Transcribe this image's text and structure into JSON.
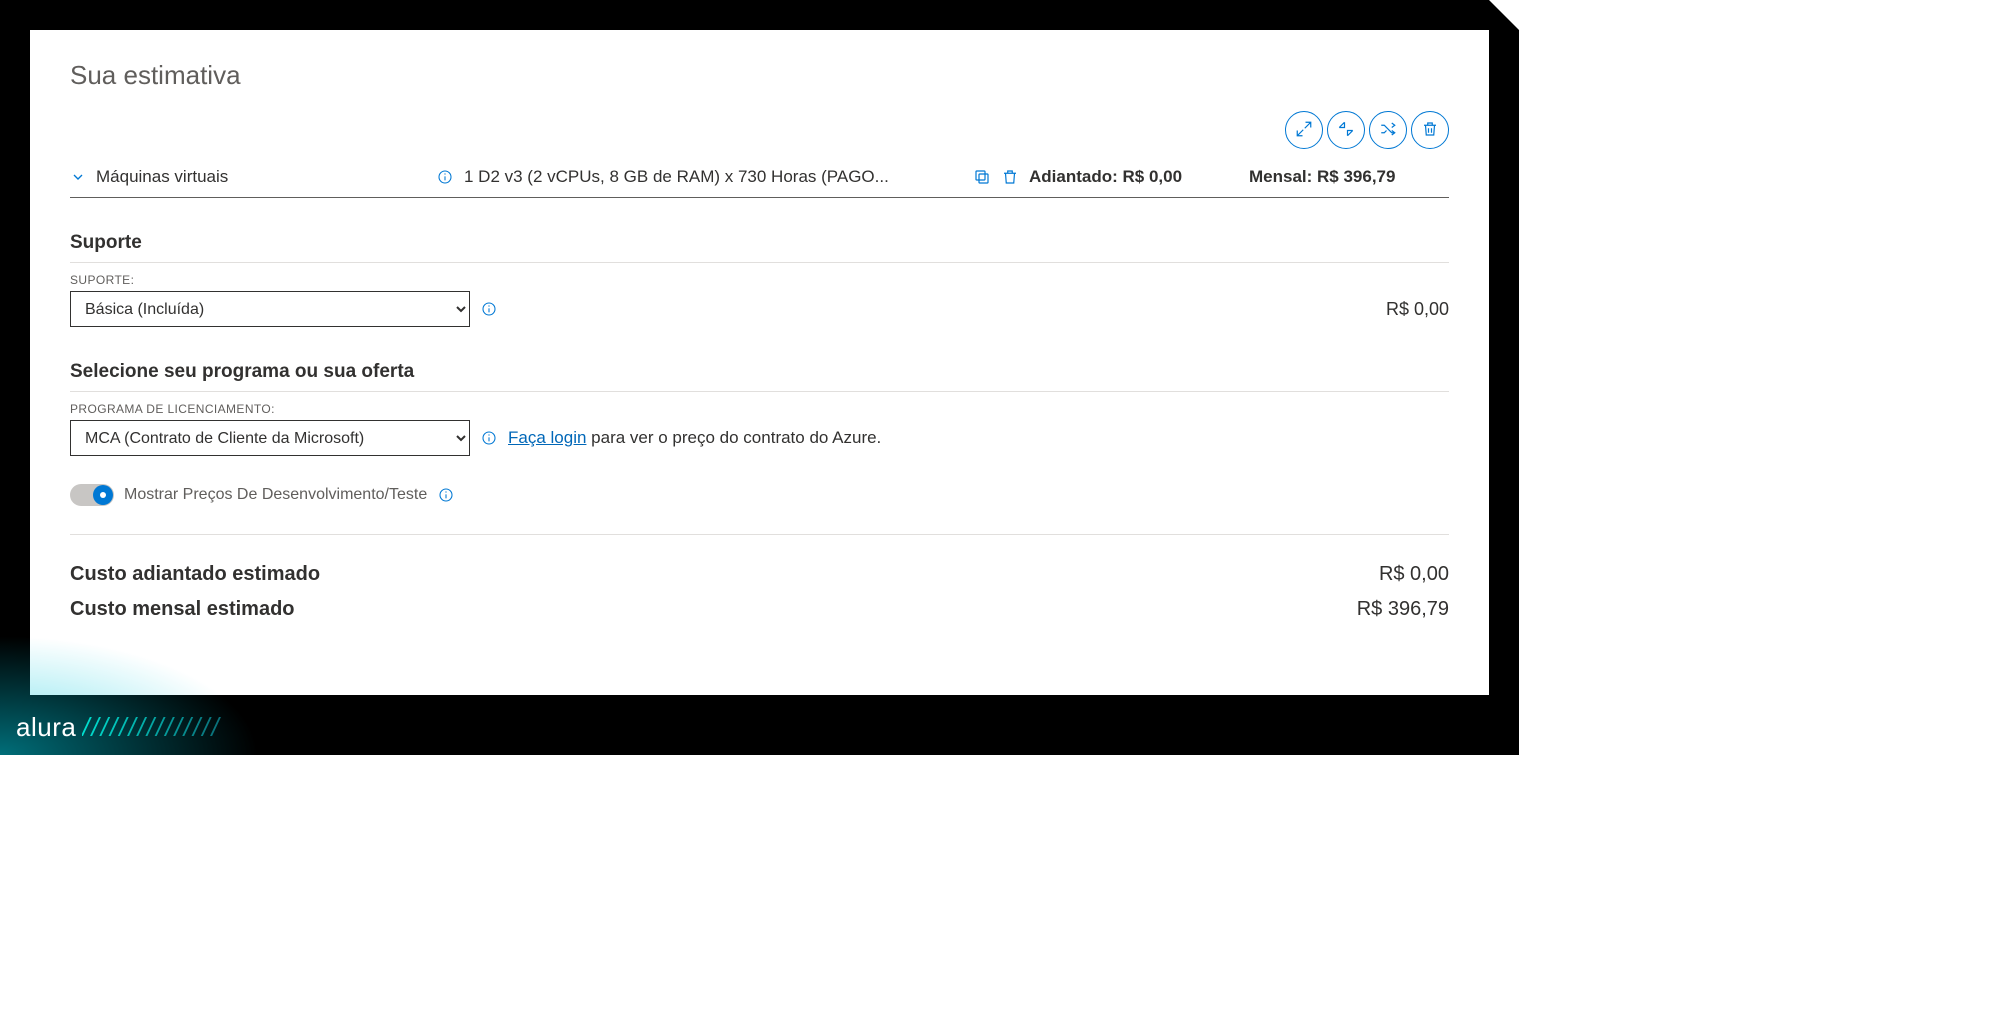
{
  "header": {
    "title": "Sua estimativa"
  },
  "toolbar": {
    "expand_title": "Expandir",
    "collapse_title": "Recolher",
    "shuffle_title": "Reorganizar",
    "delete_title": "Excluir"
  },
  "line_item": {
    "service_name": "Máquinas virtuais",
    "description": "1 D2 v3 (2 vCPUs, 8 GB de RAM) x 730 Horas (PAGO...",
    "upfront_label": "Adiantado: R$ 0,00",
    "monthly_label": "Mensal: R$ 396,79"
  },
  "support": {
    "heading": "Suporte",
    "field_label": "SUPORTE:",
    "selected": "Básica (Incluída)",
    "price": "R$ 0,00"
  },
  "program": {
    "heading": "Selecione seu programa ou sua oferta",
    "field_label": "PROGRAMA DE LICENCIAMENTO:",
    "selected": "MCA (Contrato de Cliente da Microsoft)",
    "login_link": "Faça login",
    "login_rest": " para ver o preço do contrato do Azure."
  },
  "devtest": {
    "label": "Mostrar Preços De Desenvolvimento/Teste"
  },
  "totals": {
    "upfront_label": "Custo adiantado estimado",
    "upfront_value": "R$ 0,00",
    "monthly_label": "Custo mensal estimado",
    "monthly_value": "R$ 396,79"
  },
  "watermark": {
    "brand": "alura",
    "stripes": "///////////////"
  }
}
